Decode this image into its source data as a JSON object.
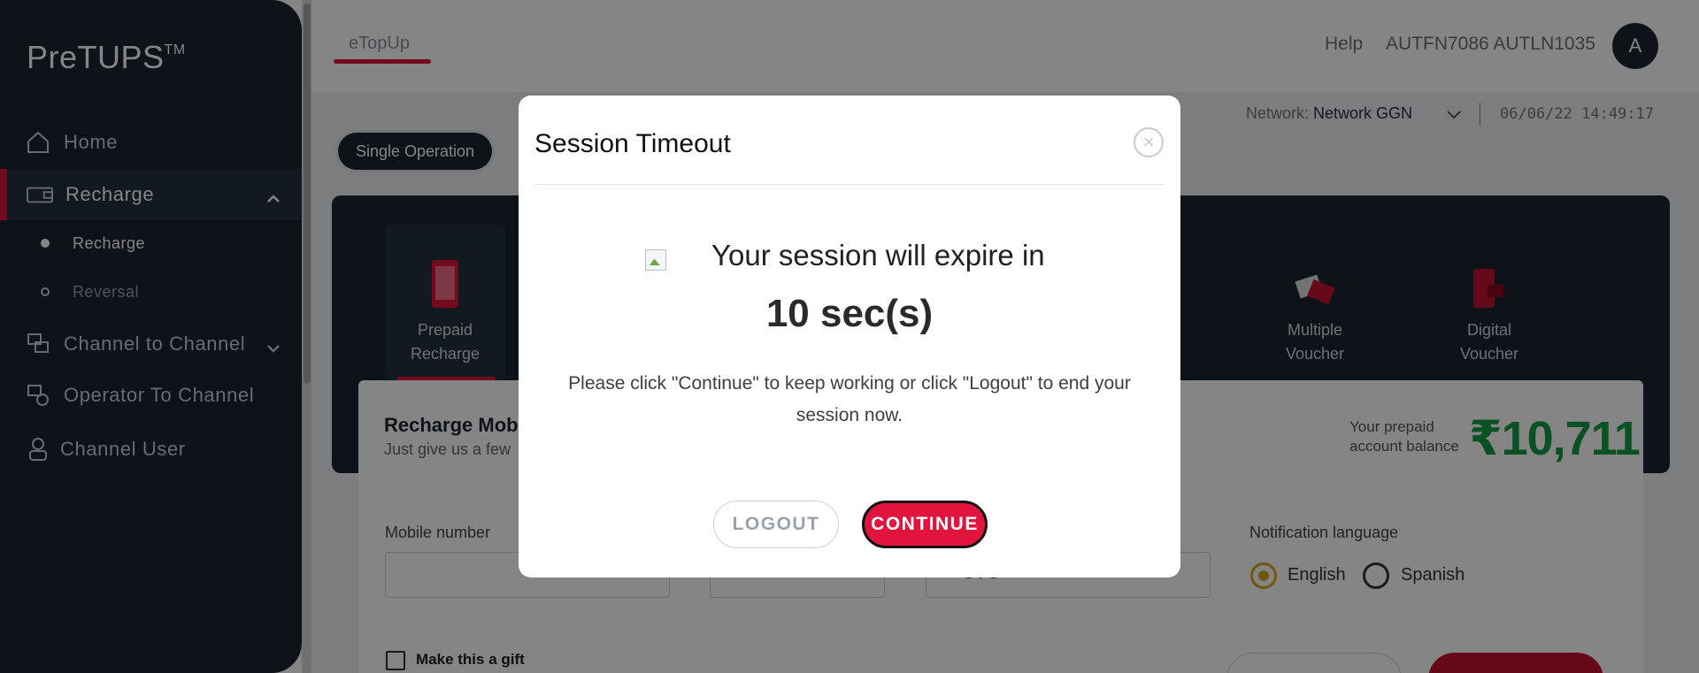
{
  "app": {
    "brand": "PreTUPS",
    "brand_mark": "TM"
  },
  "sidebar": {
    "items": [
      {
        "label": "Home",
        "icon": "home-icon"
      },
      {
        "label": "Recharge",
        "icon": "wallet-icon"
      },
      {
        "label": "Channel to Channel",
        "icon": "transfer-icon"
      },
      {
        "label": "Operator To Channel",
        "icon": "operator-transfer-icon"
      },
      {
        "label": "Channel User",
        "icon": "user-icon"
      }
    ],
    "recharge_sub": [
      {
        "label": "Recharge"
      },
      {
        "label": "Reversal"
      }
    ]
  },
  "header": {
    "tab": "eTopUp",
    "help": "Help",
    "user": "AUTFN7086 AUTLN1035",
    "avatar": "A",
    "network_label": "Network: ",
    "network_value": "Network GGN",
    "datetime": "06/06/22 14:49:17"
  },
  "operation": {
    "single": "Single Operation"
  },
  "services": [
    {
      "line1": "Prepaid",
      "line2": "Recharge"
    },
    {
      "line1": "Multiple",
      "line2": "Voucher"
    },
    {
      "line1": "Digital",
      "line2": "Voucher"
    }
  ],
  "form": {
    "title": "Recharge Mob",
    "subtitle": "Just give us a few",
    "balance_label_1": "Your prepaid",
    "balance_label_2": "account balance",
    "balance_value": "₹10,711",
    "mobile_label": "Mobile number",
    "third_field_value": "CVG",
    "notification_label": "Notification language",
    "lang_english": "English",
    "lang_spanish": "Spanish",
    "gift_label": "Make this a gift"
  },
  "modal": {
    "title": "Session Timeout",
    "expire_text": "Your session will expire in",
    "countdown": "10 sec(s)",
    "message": "Please click \"Continue\" to keep working or click \"Logout\" to end your session now.",
    "logout": "LOGOUT",
    "continue": "CONTINUE",
    "close": "×"
  },
  "colors": {
    "accent": "#e0143c",
    "sidebar": "#1c2633",
    "balance": "#149c45"
  }
}
